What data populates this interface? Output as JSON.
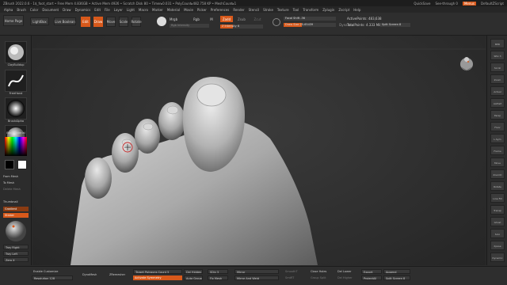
{
  "titlebar": {
    "title": "ZBrush 2022.0.6 - 1$_foot_start  • Free Mem 4.836GB • Active Mem 4926 • Scratch Disk 80 • Timer▸0.031 • PolyCount▸482.758 KP • MeshCount▸1",
    "quicksave": "QuickSave",
    "seethrough": "See-through  0",
    "menus": "Menus",
    "script": "DefaultZScript"
  },
  "menubar": {
    "items": [
      "Alpha",
      "Brush",
      "Color",
      "Document",
      "Draw",
      "Dynamics",
      "Edit",
      "File",
      "Layer",
      "Light",
      "Macro",
      "Marker",
      "Material",
      "Movie",
      "Picker",
      "Preferences",
      "Render",
      "Stencil",
      "Stroke",
      "Texture",
      "Tool",
      "Transform",
      "Zplugin",
      "Zscript",
      "Help"
    ]
  },
  "toolbar": {
    "home": "Home Page",
    "lightbox": "LightBox",
    "livebool": "Live Boolean",
    "edit": "Edit",
    "draw": "Draw",
    "move": "Move",
    "scale": "Scale",
    "rotate": "Rotate",
    "mrgb": "Mrgb",
    "rgb": "Rgb",
    "m": "M",
    "zadd": "Zadd",
    "zsub": "Zsub",
    "zcut": "Zcut",
    "rgb_intensity": "Rgb Intensity",
    "z_intensity": "Z Intensity 6",
    "z_intensity_value": 0.3,
    "focal_shift": "Focal Shift -36",
    "draw_size": "Draw Size 25.65439",
    "draw_size_value": 0.35,
    "dynamic": "Dynamic",
    "active_points": "ActivePoints: 483,638",
    "total_points": "TotalPoints: 4.333 Mil",
    "split_screen": "Split Screen  8"
  },
  "coords": "0.3253,0.844,-0.137",
  "leftshelf": {
    "brush_name": "ClayBuildup",
    "stroke_name": "FreeHand",
    "alpha_name": "BrushAlpha",
    "material_name": "BasicMaterial",
    "from_mesh": "From Mesh",
    "to_mesh": "To Mesh",
    "delete_mesh": "Delete Mesh",
    "thumbnail": "Thumbnail",
    "gradient": "Gradient",
    "sticker": "Sticker",
    "tray_right": "Tray Right",
    "tray_left": "Tray Left",
    "zero_x": "Zero X"
  },
  "rightshelf": {
    "icons": [
      "BPR",
      "SPix 3",
      "Scroll",
      "Zoom",
      "Actual",
      "AAHalf",
      "Persp",
      "Floor",
      "L.Sym",
      "Frame",
      "Move",
      "ZoomD",
      "Rotate",
      "Line Fill",
      "Transp",
      "Ghost",
      "Solo",
      "Xpose",
      "Dynamic"
    ]
  },
  "bottombar": {
    "enable_customize": "Enable Customize",
    "resolution": "Resolution 128",
    "dynamesh": "DynaMesh",
    "zremesher": "ZRemesher",
    "target_polygons": "Target Polygons Count 5",
    "activate_symmetry": "Activate Symmetry",
    "del_hidden": "Del Hidden",
    "auto_groups": "Auto Groups",
    "sdiv": "SDiv 5",
    "fix_mesh": "Fix Mesh",
    "mirror": "Mirror",
    "mirror_weld": "Mirror And Weld",
    "smooth_dim": "SmoothT",
    "smooth2": "SmtRT",
    "close_holes": "Close Holes",
    "group_split": "Group Split",
    "del_lower": "Del Lower",
    "del_higher": "Del Higher",
    "export": "Export",
    "project_all": "ProjectAll",
    "append": "Append",
    "split_screen": "Split Screen  8"
  },
  "colors": {
    "accent": "#d8591b",
    "background": "#2b2b2b"
  }
}
